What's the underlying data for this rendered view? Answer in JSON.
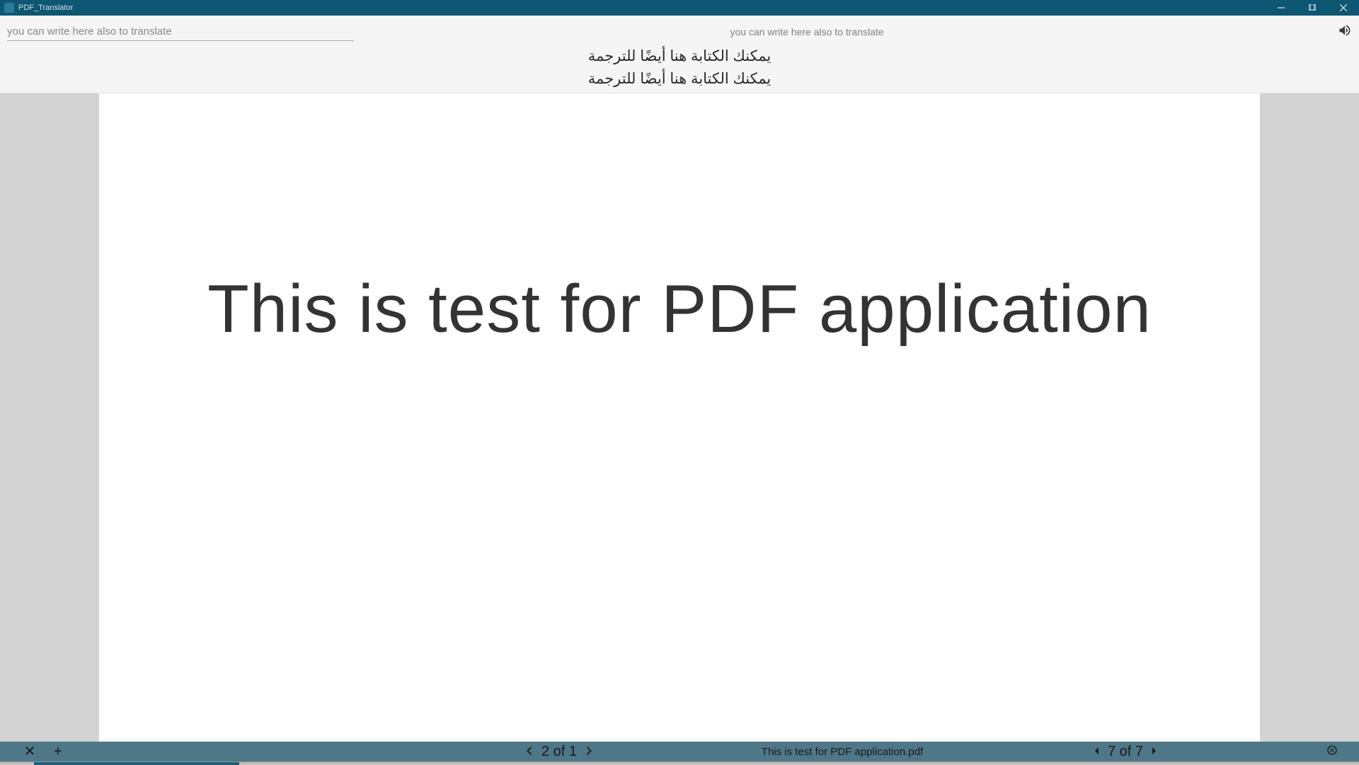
{
  "titlebar": {
    "app_title": "PDF_Translator"
  },
  "top": {
    "input_value": "you can write here also to translate",
    "center_text": "you can write here also to translate",
    "arabic_line_1": "يمكنك الكتابة هنا أيضًا للترجمة",
    "arabic_line_2": "يمكنك الكتابة هنا أيضًا للترجمة"
  },
  "pdf": {
    "page_text": "This is test for PDF application"
  },
  "bottom": {
    "zoom_out_label": "✕",
    "zoom_in_label": "+",
    "page_counter_left": "2 of 1",
    "filename": "This is test for PDF application.pdf",
    "page_counter_right": "7 of 7"
  }
}
